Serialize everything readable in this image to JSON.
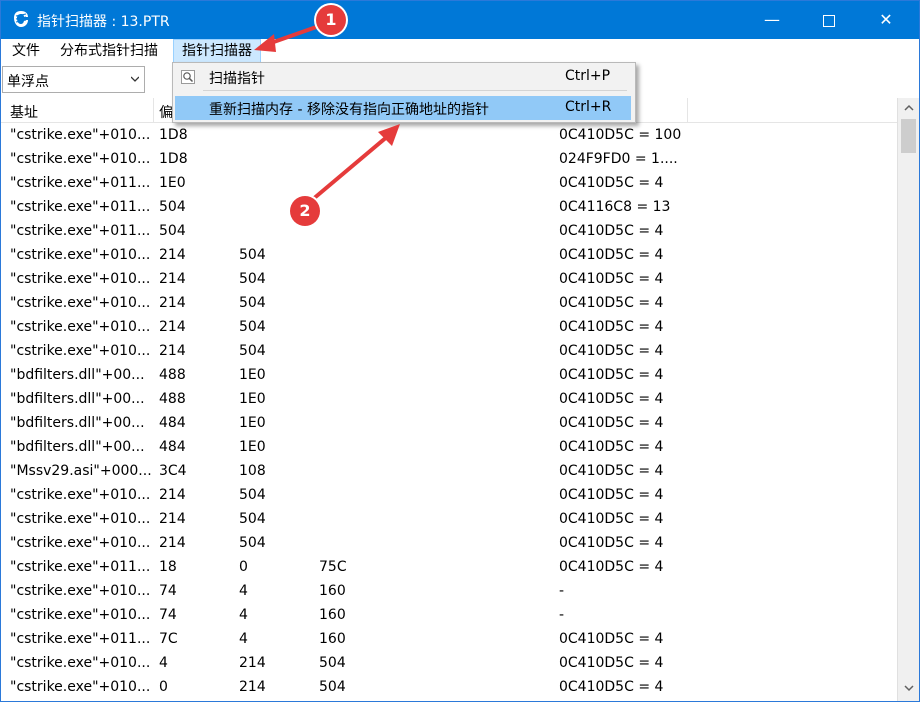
{
  "window": {
    "title": "指针扫描器 : 13.PTR",
    "minimize": "—",
    "close": "✕"
  },
  "menubar": {
    "items": [
      "文件",
      "分布式指针扫描",
      "指针扫描器"
    ]
  },
  "toolbar": {
    "combo_value": "单浮点"
  },
  "dropdown": {
    "items": [
      {
        "label": "扫描指针",
        "shortcut": "Ctrl+P",
        "icon": "scan-magnifier-icon"
      },
      {
        "label": "重新扫描内存 - 移除没有指向正确地址的指针",
        "shortcut": "Ctrl+R"
      }
    ]
  },
  "columns": [
    "基址",
    "偏"
  ],
  "rows": [
    [
      "\"cstrike.exe\"+010...",
      "1D8",
      "",
      "",
      "0C410D5C = 100"
    ],
    [
      "\"cstrike.exe\"+010...",
      "1D8",
      "",
      "",
      "024F9FD0 = 1...."
    ],
    [
      "\"cstrike.exe\"+011...",
      "1E0",
      "",
      "",
      "0C410D5C = 4"
    ],
    [
      "\"cstrike.exe\"+011...",
      "504",
      "",
      "",
      "0C4116C8 = 13"
    ],
    [
      "\"cstrike.exe\"+011...",
      "504",
      "",
      "",
      "0C410D5C = 4"
    ],
    [
      "\"cstrike.exe\"+010...",
      "214",
      "504",
      "",
      "0C410D5C = 4"
    ],
    [
      "\"cstrike.exe\"+010...",
      "214",
      "504",
      "",
      "0C410D5C = 4"
    ],
    [
      "\"cstrike.exe\"+010...",
      "214",
      "504",
      "",
      "0C410D5C = 4"
    ],
    [
      "\"cstrike.exe\"+010...",
      "214",
      "504",
      "",
      "0C410D5C = 4"
    ],
    [
      "\"cstrike.exe\"+010...",
      "214",
      "504",
      "",
      "0C410D5C = 4"
    ],
    [
      "\"bdfilters.dll\"+00...",
      "488",
      "1E0",
      "",
      "0C410D5C = 4"
    ],
    [
      "\"bdfilters.dll\"+00...",
      "488",
      "1E0",
      "",
      "0C410D5C = 4"
    ],
    [
      "\"bdfilters.dll\"+00...",
      "484",
      "1E0",
      "",
      "0C410D5C = 4"
    ],
    [
      "\"bdfilters.dll\"+00...",
      "484",
      "1E0",
      "",
      "0C410D5C = 4"
    ],
    [
      "\"Mssv29.asi\"+000...",
      "3C4",
      "108",
      "",
      "0C410D5C = 4"
    ],
    [
      "\"cstrike.exe\"+010...",
      "214",
      "504",
      "",
      "0C410D5C = 4"
    ],
    [
      "\"cstrike.exe\"+010...",
      "214",
      "504",
      "",
      "0C410D5C = 4"
    ],
    [
      "\"cstrike.exe\"+010...",
      "214",
      "504",
      "",
      "0C410D5C = 4"
    ],
    [
      "\"cstrike.exe\"+011...",
      "18",
      "0",
      "75C",
      "0C410D5C = 4"
    ],
    [
      "\"cstrike.exe\"+010...",
      "74",
      "4",
      "160",
      "-"
    ],
    [
      "\"cstrike.exe\"+010...",
      "74",
      "4",
      "160",
      "-"
    ],
    [
      "\"cstrike.exe\"+011...",
      "7C",
      "4",
      "160",
      "0C410D5C = 4"
    ],
    [
      "\"cstrike.exe\"+010...",
      "4",
      "214",
      "504",
      "0C410D5C = 4"
    ],
    [
      "\"cstrike.exe\"+010...",
      "0",
      "214",
      "504",
      "0C410D5C = 4"
    ]
  ],
  "annotations": {
    "badge1": "1",
    "badge2": "2",
    "color": "#e53b3b"
  }
}
